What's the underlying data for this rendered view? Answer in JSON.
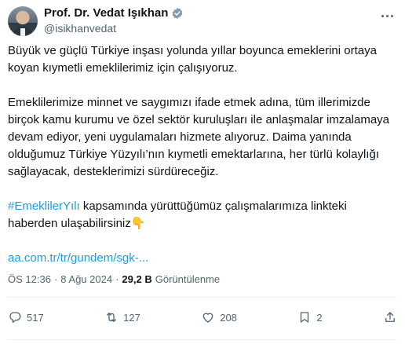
{
  "author": {
    "display_name": "Prof. Dr. Vedat Işıkhan",
    "handle": "@isikhanvedat"
  },
  "tweet": {
    "paragraph1": "Büyük ve güçlü Türkiye inşası yolunda yıllar boyunca emeklerini ortaya koyan kıymetli emeklilerimiz için çalışıyoruz.",
    "paragraph2": "Emeklilerimize minnet ve saygımızı ifade etmek adına, tüm illerimizde birçok kamu kurumu ve özel sektör kuruluşları ile anlaşmalar imzalamaya devam ediyor, yeni uygulamaları hizmete alıyoruz. Daima yanında olduğumuz Türkiye Yüzyılı’nın kıymetli emektarlarına, her türlü kolaylığı sağlayacak, desteklerimizi sürdüreceğiz.",
    "hashtag": "#EmeklilerYılı",
    "paragraph3_rest": " kapsamında yürüttüğümüz çalışmalarımıza linkteki haberden ulaşabilirsiniz",
    "emoji": "👇",
    "link": "aa.com.tr/tr/gundem/sgk-..."
  },
  "meta": {
    "time": "ÖS 12:36",
    "separator": "·",
    "date": "8 Ağu 2024",
    "views_count": "29,2 B",
    "views_label": "Görüntülenme"
  },
  "actions": {
    "replies": "517",
    "retweets": "127",
    "likes": "208",
    "bookmarks": "2"
  },
  "icons": {
    "verified": "verified-badge-icon",
    "more": "more-icon",
    "reply": "reply-icon",
    "retweet": "retweet-icon",
    "like": "like-icon",
    "bookmark": "bookmark-icon",
    "share": "share-icon"
  },
  "colors": {
    "accent": "#1d9bf0",
    "text": "#0f1419",
    "muted": "#536471"
  }
}
